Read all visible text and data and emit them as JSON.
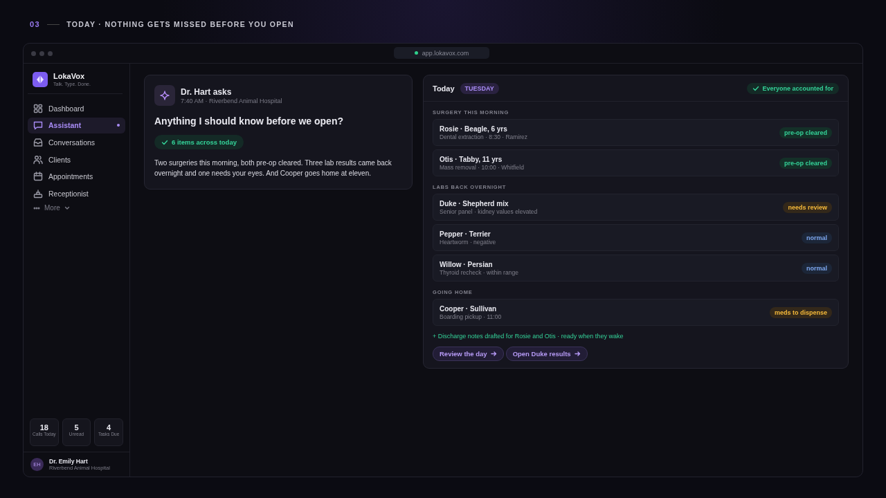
{
  "header": {
    "number": "03",
    "title": "TODAY · NOTHING GETS MISSED BEFORE YOU OPEN"
  },
  "window": {
    "url": "app.lokavox.com",
    "secure": true
  },
  "sidebar": {
    "brand": {
      "name": "LokaVox",
      "tagline": "Talk. Type. Done."
    },
    "items": [
      {
        "label": "Dashboard",
        "selected": false,
        "unread": false
      },
      {
        "label": "Assistant",
        "selected": true,
        "unread": true
      },
      {
        "label": "Conversations",
        "selected": false,
        "unread": false
      },
      {
        "label": "Clients",
        "selected": false,
        "unread": false
      },
      {
        "label": "Appointments",
        "selected": false,
        "unread": false
      },
      {
        "label": "Receptionist",
        "selected": false,
        "unread": false
      }
    ],
    "more": "More",
    "stats": [
      {
        "value": "18",
        "label": "Calls Today"
      },
      {
        "value": "5",
        "label": "Unread"
      },
      {
        "value": "4",
        "label": "Tasks Due"
      }
    ],
    "user": {
      "initials": "EH",
      "name": "Dr. Emily Hart",
      "org": "Riverbend Animal Hospital"
    }
  },
  "question": {
    "author": "Dr. Hart asks",
    "meta": "7:40 AM · Riverbend Animal Hospital",
    "text": "Anything I should know before we open?",
    "chip": "6 items across today",
    "answer": "Two surgeries this morning, both pre-op cleared. Three lab results came back overnight and one needs your eyes. And Cooper goes home at eleven."
  },
  "today": {
    "title": "Today",
    "day": "TUESDAY",
    "status": "Everyone accounted for",
    "sections": [
      {
        "heading": "SURGERY THIS MORNING",
        "rows": [
          {
            "name": "Rosie · Beagle, 6 yrs",
            "detail": "Dental extraction · 8:30 · Ramirez",
            "tag": "pre-op cleared",
            "kind": "success"
          },
          {
            "name": "Otis · Tabby, 11 yrs",
            "detail": "Mass removal · 10:00 · Whitfield",
            "tag": "pre-op cleared",
            "kind": "success"
          }
        ]
      },
      {
        "heading": "LABS BACK OVERNIGHT",
        "rows": [
          {
            "name": "Duke · Shepherd mix",
            "detail": "Senior panel · kidney values elevated",
            "tag": "needs review",
            "kind": "warning"
          },
          {
            "name": "Pepper · Terrier",
            "detail": "Heartworm · negative",
            "tag": "normal",
            "kind": "info"
          },
          {
            "name": "Willow · Persian",
            "detail": "Thyroid recheck · within range",
            "tag": "normal",
            "kind": "info"
          }
        ]
      },
      {
        "heading": "GOING HOME",
        "rows": [
          {
            "name": "Cooper · Sullivan",
            "detail": "Boarding pickup · 11:00",
            "tag": "meds to dispense",
            "kind": "warning"
          }
        ]
      }
    ],
    "note": "+ Discharge notes drafted for Rosie and Otis · ready when they wake",
    "actions": [
      "Review the day",
      "Open Duke results"
    ]
  }
}
